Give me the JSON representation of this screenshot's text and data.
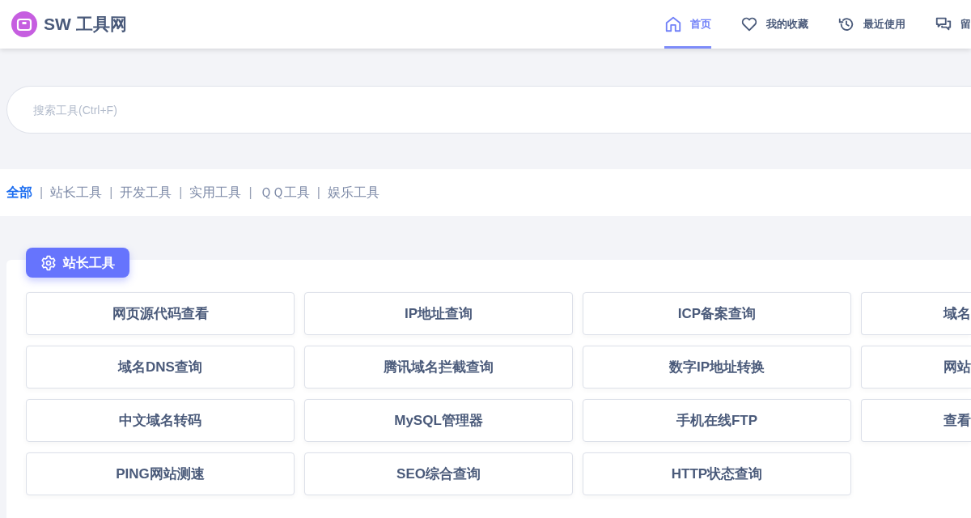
{
  "brand": {
    "name": "SW 工具网"
  },
  "nav": [
    {
      "label": "首页",
      "kind": "home",
      "selected": true
    },
    {
      "label": "我的收藏",
      "kind": "heart",
      "selected": false
    },
    {
      "label": "最近使用",
      "kind": "history",
      "selected": false
    },
    {
      "label": "留",
      "kind": "chat",
      "selected": false
    }
  ],
  "search": {
    "placeholder": "搜索工具(Ctrl+F)"
  },
  "categories": [
    {
      "label": "全部",
      "selected": true
    },
    {
      "separator": "|",
      "label": "站长工具",
      "selected": false
    },
    {
      "separator": "|",
      "label": "开发工具",
      "selected": false
    },
    {
      "separator": "|",
      "label": "实用工具",
      "selected": false
    },
    {
      "separator": "|",
      "label": "ＱＱ工具",
      "selected": false
    },
    {
      "separator": "|",
      "label": "娱乐工具",
      "selected": false
    }
  ],
  "section": {
    "title": "站长工具",
    "tools": [
      {
        "label": "网页源代码查看"
      },
      {
        "label": "IP地址查询"
      },
      {
        "label": "ICP备案查询"
      },
      {
        "label": "域名",
        "kind": "cut"
      },
      {
        "label": "域名DNS查询"
      },
      {
        "label": "腾讯域名拦截查询"
      },
      {
        "label": "数字IP地址转换"
      },
      {
        "label": "网站",
        "kind": "cut"
      },
      {
        "label": "中文域名转码"
      },
      {
        "label": "MySQL管理器"
      },
      {
        "label": "手机在线FTP"
      },
      {
        "label": "查看",
        "kind": "cut"
      },
      {
        "label": "PING网站测速"
      },
      {
        "label": "SEO综合查询"
      },
      {
        "label": "HTTP状态查询"
      }
    ]
  }
}
